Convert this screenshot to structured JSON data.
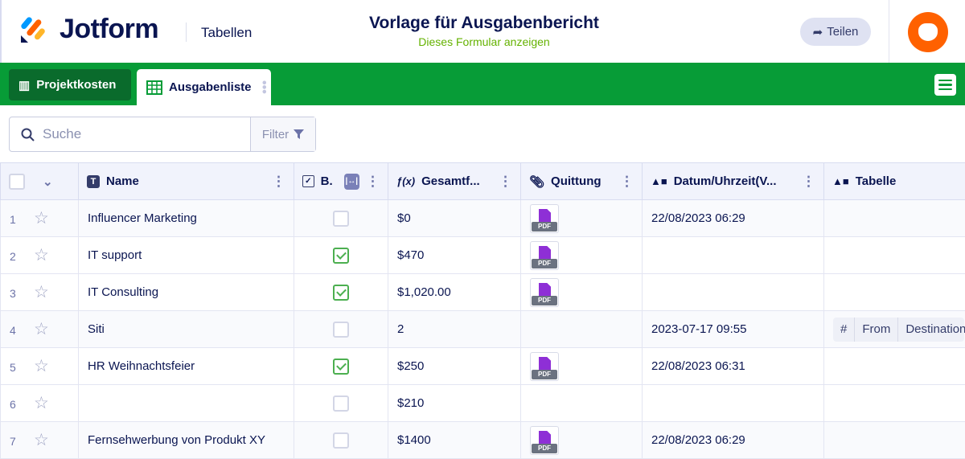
{
  "header": {
    "brand": "Jotform",
    "section": "Tabellen",
    "title": "Vorlage für Ausgabenbericht",
    "subtitle": "Dieses Formular anzeigen",
    "share_label": "Teilen"
  },
  "tabs": [
    {
      "label": "Projektkosten",
      "active": false
    },
    {
      "label": "Ausgabenliste",
      "active": true
    }
  ],
  "search": {
    "placeholder": "Suche",
    "filter_label": "Filter"
  },
  "columns": [
    "Name",
    "B.",
    "Gesamtf...",
    "Quittung",
    "Datum/Uhrzeit(V...",
    "Tabelle"
  ],
  "rows": [
    {
      "num": "1",
      "name": "Influencer Marketing",
      "checked": false,
      "total": "$0",
      "receipt": true,
      "date": "22/08/2023 06:29"
    },
    {
      "num": "2",
      "name": "IT support",
      "checked": true,
      "total": "$470",
      "receipt": true,
      "date": ""
    },
    {
      "num": "3",
      "name": "IT Consulting",
      "checked": true,
      "total": "$1,020.00",
      "receipt": true,
      "date": ""
    },
    {
      "num": "4",
      "name": "Siti",
      "checked": false,
      "total": "2",
      "receipt": false,
      "date": "2023-07-17 09:55"
    },
    {
      "num": "5",
      "name": "HR Weihnachtsfeier",
      "checked": true,
      "total": "$250",
      "receipt": true,
      "date": "22/08/2023 06:31"
    },
    {
      "num": "6",
      "name": "",
      "checked": false,
      "total": "$210",
      "receipt": false,
      "date": ""
    },
    {
      "num": "7",
      "name": "Fernsehwerbung von Produkt XY",
      "checked": false,
      "total": "$1400",
      "receipt": true,
      "date": "22/08/2023 06:29"
    }
  ],
  "mini_table_headers": [
    "#",
    "From",
    "Destination"
  ],
  "pdf_label": "PDF",
  "colors": {
    "brand_green": "#079c37",
    "accent_orange": "#ff6100",
    "navy": "#0a1551",
    "subtitle_green": "#64b200"
  }
}
